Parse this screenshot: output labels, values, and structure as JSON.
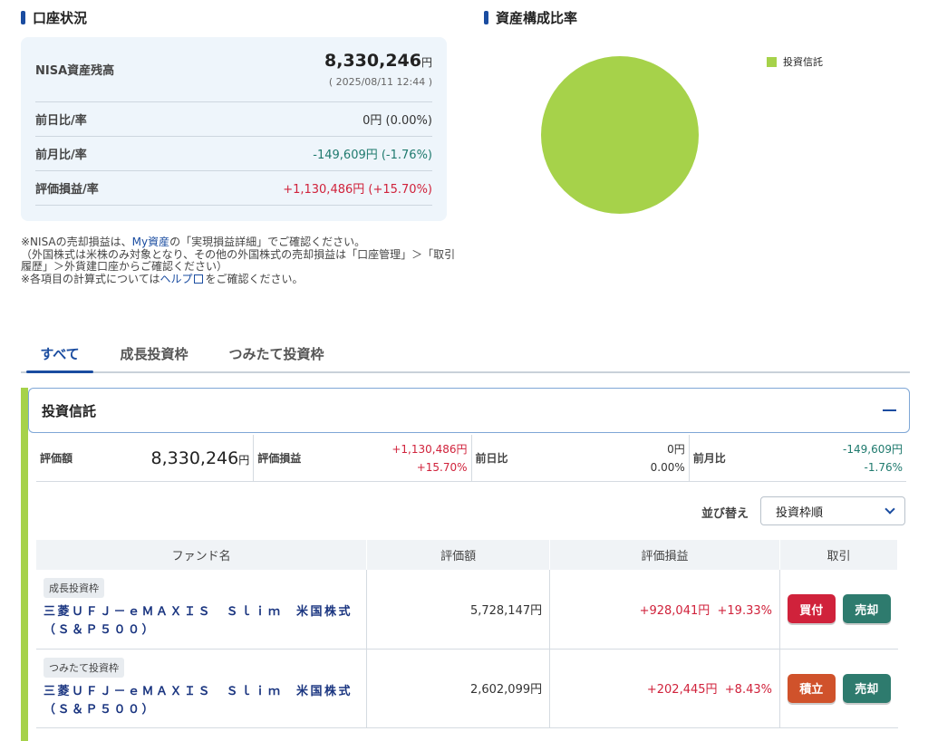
{
  "account": {
    "title": "口座状況",
    "nisa_label": "NISA資産残高",
    "nisa_value": "8,330,246",
    "yen": "円",
    "timestamp": "( 2025/08/11 12:44 )",
    "rows": [
      {
        "label": "前日比/率",
        "value": "0円 (0.00%)",
        "tone": "neutral"
      },
      {
        "label": "前月比/率",
        "value": "-149,609円 (-1.76%)",
        "tone": "neg"
      },
      {
        "label": "評価損益/率",
        "value": "+1,130,486円 (+15.70%)",
        "tone": "pos"
      }
    ]
  },
  "notes": {
    "line1_a": "※NISAの売却損益は、",
    "line1_link": "My資産",
    "line1_b": "の「実現損益詳細」でご確認ください。",
    "line2": "（外国株式は米株のみ対象となり、その他の外国株式の売却損益は「口座管理」＞「取引履歴」＞外貨建口座からご確認ください）",
    "line3_a": "※各項目の計算式については",
    "line3_link": "ヘルプ",
    "line3_b": "をご確認ください。"
  },
  "composition": {
    "title": "資産構成比率",
    "legend": [
      {
        "label": "投資信託",
        "color": "#a6d24a"
      }
    ],
    "pie": [
      {
        "label": "投資信託",
        "share": 100,
        "color": "#a6d24a"
      }
    ]
  },
  "tabs": [
    "すべて",
    "成長投資枠",
    "つみたて投資枠"
  ],
  "fund_section": {
    "title": "投資信託",
    "summary": {
      "eval_label": "評価額",
      "eval_value": "8,330,246",
      "yen": "円",
      "pl_label": "評価損益",
      "pl_value": "+1,130,486円",
      "pl_rate": "+15.70%",
      "day_label": "前日比",
      "day_value": "0円",
      "day_rate": "0.00%",
      "month_label": "前月比",
      "month_value": "-149,609円",
      "month_rate": "-1.76%"
    },
    "sort_label": "並び替え",
    "sort_value": "投資枠順",
    "columns": [
      "ファンド名",
      "評価額",
      "評価損益",
      "取引"
    ],
    "rows": [
      {
        "tag": "成長投資枠",
        "name": "三菱ＵＦＪ－ｅＭＡＸＩＳ　Ｓｌｉｍ　米国株式（Ｓ＆Ｐ５００）",
        "value": "5,728,147円",
        "pl": "+928,041円",
        "rate": "+19.33%",
        "btn1": "買付",
        "btn2": "売却"
      },
      {
        "tag": "つみたて投資枠",
        "name": "三菱ＵＦＪ－ｅＭＡＸＩＳ　Ｓｌｉｍ　米国株式（Ｓ＆Ｐ５００）",
        "value": "2,602,099円",
        "pl": "+202,445円",
        "rate": "+8.43%",
        "btn1": "積立",
        "btn2": "売却"
      }
    ]
  }
}
